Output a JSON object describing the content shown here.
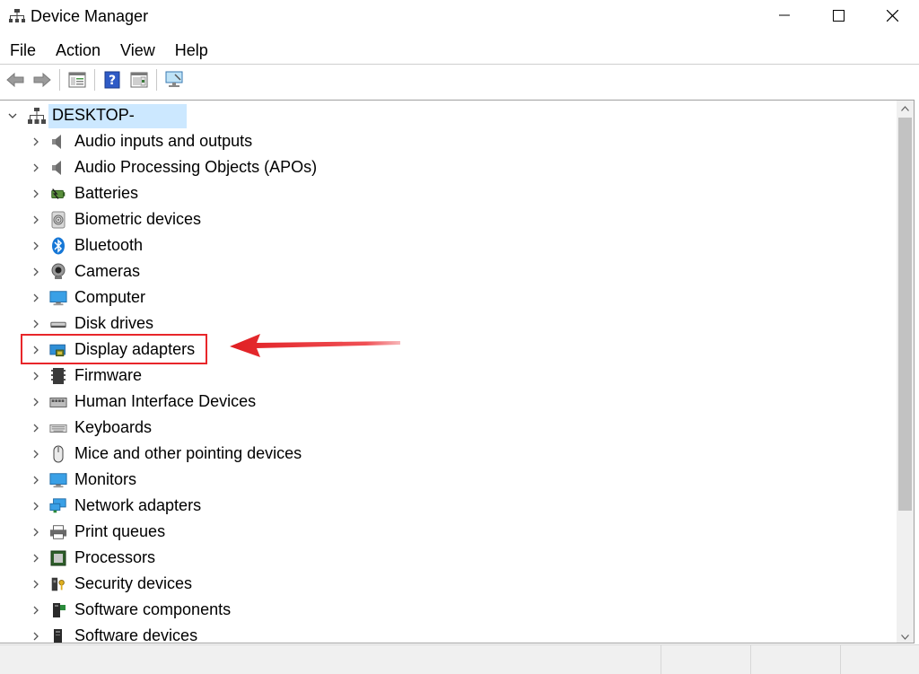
{
  "window": {
    "title": "Device Manager"
  },
  "menu": [
    "File",
    "Action",
    "View",
    "Help"
  ],
  "toolbar": {
    "buttons": [
      "back-icon",
      "forward-icon",
      "properties-icon",
      "help-icon",
      "show-hidden-icon",
      "scan-hardware-icon"
    ]
  },
  "tree": {
    "root_label": "DESKTOP-",
    "categories": [
      {
        "label": "Audio inputs and outputs",
        "icon": "speaker-icon"
      },
      {
        "label": "Audio Processing Objects (APOs)",
        "icon": "speaker-icon"
      },
      {
        "label": "Batteries",
        "icon": "battery-icon"
      },
      {
        "label": "Biometric devices",
        "icon": "fingerprint-icon"
      },
      {
        "label": "Bluetooth",
        "icon": "bluetooth-icon"
      },
      {
        "label": "Cameras",
        "icon": "camera-icon"
      },
      {
        "label": "Computer",
        "icon": "computer-icon"
      },
      {
        "label": "Disk drives",
        "icon": "disk-drive-icon"
      },
      {
        "label": "Display adapters",
        "icon": "display-adapter-icon"
      },
      {
        "label": "Firmware",
        "icon": "firmware-icon"
      },
      {
        "label": "Human Interface Devices",
        "icon": "hid-icon"
      },
      {
        "label": "Keyboards",
        "icon": "keyboard-icon"
      },
      {
        "label": "Mice and other pointing devices",
        "icon": "mouse-icon"
      },
      {
        "label": "Monitors",
        "icon": "monitor-icon"
      },
      {
        "label": "Network adapters",
        "icon": "network-icon"
      },
      {
        "label": "Print queues",
        "icon": "printer-icon"
      },
      {
        "label": "Processors",
        "icon": "processor-icon"
      },
      {
        "label": "Security devices",
        "icon": "security-icon"
      },
      {
        "label": "Software components",
        "icon": "software-component-icon"
      },
      {
        "label": "Software devices",
        "icon": "software-device-icon"
      }
    ]
  },
  "colors": {
    "selection": "#cce8ff",
    "annotation": "#e8262a"
  }
}
